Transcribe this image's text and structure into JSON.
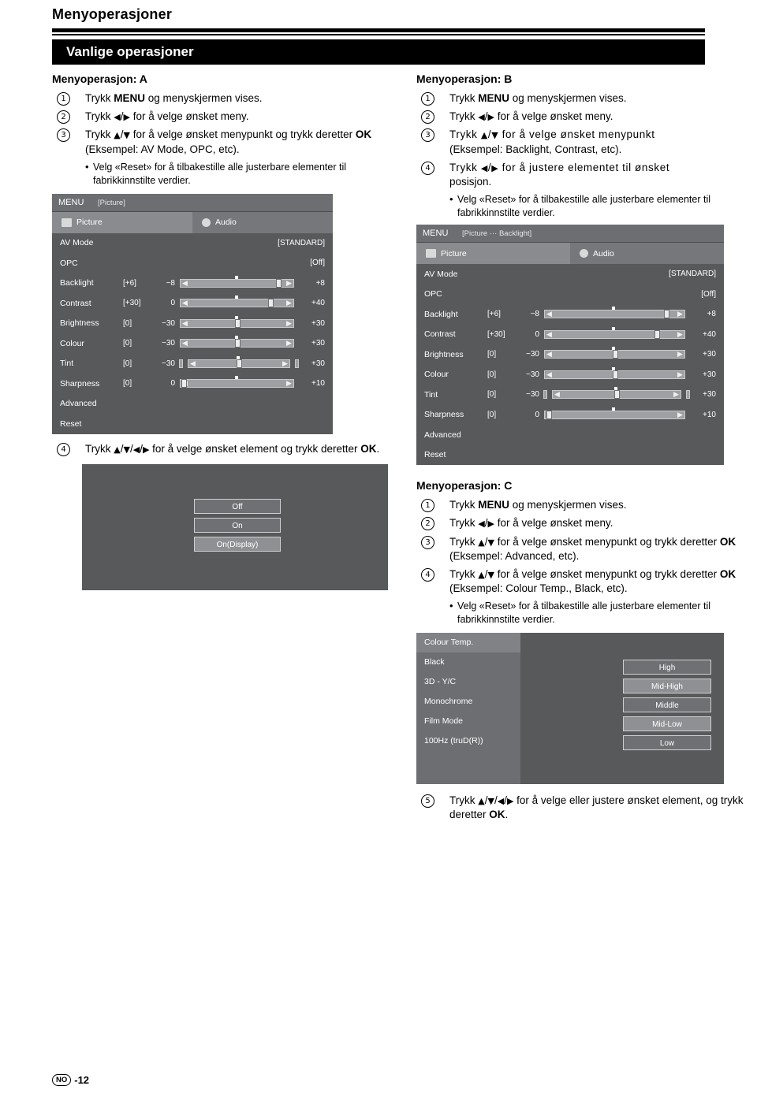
{
  "header": {
    "title": "Menyoperasjoner",
    "section_bar": "Vanlige operasjoner"
  },
  "menu_a": {
    "heading": "Menyoperasjon: A",
    "steps": [
      {
        "num": "1",
        "text_html": "Trykk <b>MENU</b> og menyskjermen vises."
      },
      {
        "num": "2",
        "text_html": "Trykk <span class=\"arr\">◀</span>/<span class=\"arr\">▶</span> for å velge ønsket meny."
      },
      {
        "num": "3",
        "text_html": "Trykk <span class=\"arr\">▲</span>/<span class=\"arr\">▼</span> for å velge ønsket menypunkt og trykk deretter <b>OK</b> (Eksempel: AV Mode, OPC, etc)."
      }
    ],
    "bullet": "Velg «Reset» for å tilbakestille alle justerbare elementer til fabrikkinnstilte verdier.",
    "step4": {
      "num": "4",
      "text_html": "Trykk <span class=\"arr\">▲</span>/<span class=\"arr\">▼</span>/<span class=\"arr\">◀</span>/<span class=\"arr\">▶</span> for å velge ønsket element og trykk deretter <b>OK</b>."
    },
    "options": [
      {
        "label": "Off",
        "selected": false
      },
      {
        "label": "On",
        "selected": false
      },
      {
        "label": "On(Display)",
        "selected": true
      }
    ]
  },
  "menu_b": {
    "heading": "Menyoperasjon: B",
    "steps": [
      {
        "num": "1",
        "text_html": "Trykk <b>MENU</b> og menyskjermen vises."
      },
      {
        "num": "2",
        "text_html": "Trykk <span class=\"arr\">◀</span>/<span class=\"arr\">▶</span> for å velge ønsket meny."
      },
      {
        "num": "3",
        "text_html": "<span class=\"tracked\">Trykk <span class=\"arr\">▲</span>/<span class=\"arr\">▼</span> for å velge ønsket menypunkt</span><br>(Eksempel: Backlight, Contrast, etc)."
      },
      {
        "num": "4",
        "text_html": "<span class=\"tracked\">Trykk <span class=\"arr\">◀</span>/<span class=\"arr\">▶</span> for å justere elementet til ønsket</span><br>posisjon."
      }
    ],
    "bullet": "Velg «Reset» for å tilbakestille alle justerbare elementer til fabrikkinnstilte verdier."
  },
  "menu_c": {
    "heading": "Menyoperasjon: C",
    "steps": [
      {
        "num": "1",
        "text_html": "Trykk <b>MENU</b> og menyskjermen vises."
      },
      {
        "num": "2",
        "text_html": "Trykk <span class=\"arr\">◀</span>/<span class=\"arr\">▶</span> for å velge ønsket meny."
      },
      {
        "num": "3",
        "text_html": "Trykk <span class=\"arr\">▲</span>/<span class=\"arr\">▼</span> for å velge ønsket menypunkt og trykk deretter <b>OK</b> (Eksempel: Advanced, etc)."
      },
      {
        "num": "4",
        "text_html": "Trykk <span class=\"arr\">▲</span>/<span class=\"arr\">▼</span> for å velge ønsket menypunkt og trykk deretter <b>OK</b> (Eksempel: Colour Temp., Black, etc)."
      }
    ],
    "bullet": "Velg «Reset» for å tilbakestille alle justerbare elementer til fabrikkinnstilte verdier.",
    "step5": {
      "num": "5",
      "text_html": "Trykk <span class=\"arr\">▲</span>/<span class=\"arr\">▼</span>/<span class=\"arr\">◀</span>/<span class=\"arr\">▶</span> for å velge eller justere ønsket element, og trykk deretter <b>OK</b>."
    }
  },
  "osd_a": {
    "menu_label": "MENU",
    "path": "[Picture]",
    "tabs": [
      {
        "label": "Picture",
        "icon": "picture-icon",
        "active": true
      },
      {
        "label": "Audio",
        "icon": "speaker-icon",
        "active": false
      }
    ],
    "rows": [
      {
        "name": "AV Mode",
        "right": "[STANDARD]",
        "type": "value"
      },
      {
        "name": "OPC",
        "right": "[Off]",
        "type": "value"
      },
      {
        "name": "Backlight",
        "val": "[+6]",
        "min": "−8",
        "max": "+8",
        "type": "slider",
        "pos": 87,
        "caps": false
      },
      {
        "name": "Contrast",
        "val": "[+30]",
        "min": "0",
        "max": "+40",
        "type": "slider",
        "pos": 80,
        "caps": false
      },
      {
        "name": "Brightness",
        "val": "[0]",
        "min": "−30",
        "max": "+30",
        "type": "slider",
        "pos": 50,
        "caps": false
      },
      {
        "name": "Colour",
        "val": "[0]",
        "min": "−30",
        "max": "+30",
        "type": "slider",
        "pos": 50,
        "caps": false
      },
      {
        "name": "Tint",
        "val": "[0]",
        "min": "−30",
        "max": "+30",
        "type": "slider",
        "pos": 50,
        "caps": true
      },
      {
        "name": "Sharpness",
        "val": "[0]",
        "min": "0",
        "max": "+10",
        "type": "slider",
        "pos": 3,
        "caps": false
      },
      {
        "name": "Advanced",
        "type": "plain"
      },
      {
        "name": "Reset",
        "type": "plain"
      }
    ]
  },
  "osd_b": {
    "menu_label": "MENU",
    "path": "[Picture ··· Backlight]",
    "tabs": [
      {
        "label": "Picture",
        "icon": "picture-icon",
        "active": true
      },
      {
        "label": "Audio",
        "icon": "speaker-icon",
        "active": false
      }
    ],
    "rows": [
      {
        "name": "AV Mode",
        "right": "[STANDARD]",
        "type": "value"
      },
      {
        "name": "OPC",
        "right": "[Off]",
        "type": "value"
      },
      {
        "name": "Backlight",
        "val": "[+6]",
        "min": "−8",
        "max": "+8",
        "type": "slider",
        "pos": 87,
        "caps": false
      },
      {
        "name": "Contrast",
        "val": "[+30]",
        "min": "0",
        "max": "+40",
        "type": "slider",
        "pos": 80,
        "caps": false
      },
      {
        "name": "Brightness",
        "val": "[0]",
        "min": "−30",
        "max": "+30",
        "type": "slider",
        "pos": 50,
        "caps": false
      },
      {
        "name": "Colour",
        "val": "[0]",
        "min": "−30",
        "max": "+30",
        "type": "slider",
        "pos": 50,
        "caps": false
      },
      {
        "name": "Tint",
        "val": "[0]",
        "min": "−30",
        "max": "+30",
        "type": "slider",
        "pos": 50,
        "caps": true
      },
      {
        "name": "Sharpness",
        "val": "[0]",
        "min": "0",
        "max": "+10",
        "type": "slider",
        "pos": 3,
        "caps": false
      },
      {
        "name": "Advanced",
        "type": "plain"
      },
      {
        "name": "Reset",
        "type": "plain"
      }
    ]
  },
  "osd_c": {
    "left_items": [
      {
        "label": "Colour Temp.",
        "highlight": true
      },
      {
        "label": "Black",
        "highlight": false
      },
      {
        "label": "3D - Y/C",
        "highlight": false
      },
      {
        "label": "Monochrome",
        "highlight": false
      },
      {
        "label": "Film Mode",
        "highlight": false
      },
      {
        "label": "100Hz (truD(R))",
        "highlight": false
      }
    ],
    "buttons": [
      {
        "label": "High",
        "selected": false
      },
      {
        "label": "Mid-High",
        "selected": true
      },
      {
        "label": "Middle",
        "selected": false
      },
      {
        "label": "Mid-Low",
        "selected": true
      },
      {
        "label": "Low",
        "selected": false
      }
    ]
  },
  "footer": {
    "locale": "NO",
    "page": "-12"
  }
}
